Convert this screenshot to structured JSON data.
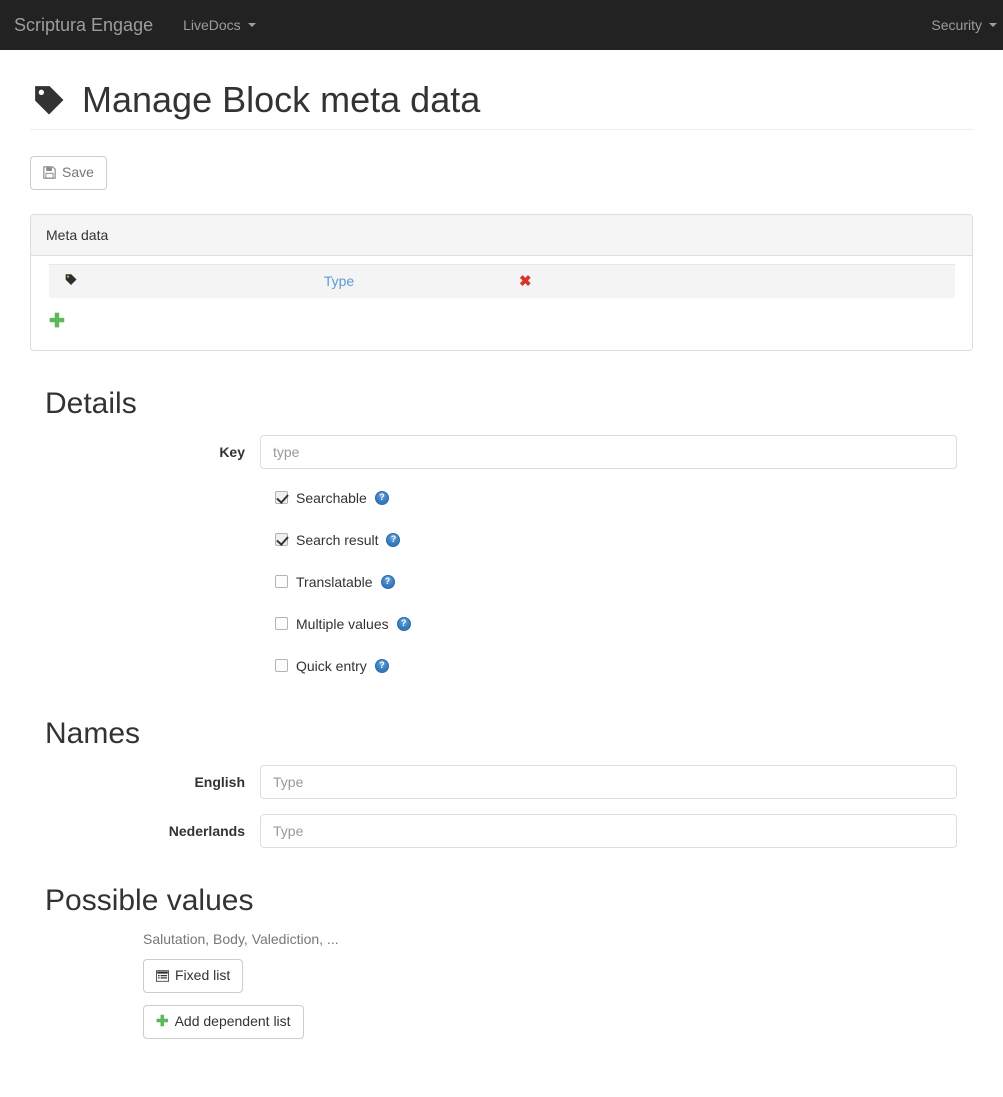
{
  "navbar": {
    "brand": "Scriptura Engage",
    "left_items": [
      {
        "label": "LiveDocs",
        "icon": "caret-down-icon"
      }
    ],
    "right_items": [
      {
        "label": "Security",
        "icon": "caret-down-icon"
      }
    ]
  },
  "header": {
    "icon": "tag-icon",
    "title": "Manage Block meta data"
  },
  "toolbar": {
    "save_label": "Save",
    "save_icon": "save-floppy-icon"
  },
  "meta_panel": {
    "heading": "Meta data",
    "rows": [
      {
        "icon": "tag-icon",
        "name": "Type",
        "delete_icon": "✖"
      }
    ],
    "add_icon": "✚"
  },
  "details": {
    "title": "Details",
    "key_label": "Key",
    "key_value": "",
    "key_placeholder": "type",
    "checkboxes": [
      {
        "label": "Searchable",
        "checked": true,
        "help": "?"
      },
      {
        "label": "Search result",
        "checked": true,
        "help": "?"
      },
      {
        "label": "Translatable",
        "checked": false,
        "help": "?"
      },
      {
        "label": "Multiple values",
        "checked": false,
        "help": "?"
      },
      {
        "label": "Quick entry",
        "checked": false,
        "help": "?"
      }
    ]
  },
  "names": {
    "title": "Names",
    "fields": [
      {
        "label": "English",
        "value": "",
        "placeholder": "Type"
      },
      {
        "label": "Nederlands",
        "value": "",
        "placeholder": "Type"
      }
    ]
  },
  "possible_values": {
    "title": "Possible values",
    "note": "Salutation, Body, Valediction, ...",
    "fixed_list_label": "Fixed list",
    "fixed_list_icon": "list-icon",
    "add_dependent_label": "Add dependent list",
    "add_dependent_icon": "✚"
  },
  "colors": {
    "navbar_bg": "#222222",
    "navbar_text": "#9d9d9d",
    "link_blue": "#5b9bd5",
    "delete_red": "#d9342b",
    "add_green": "#5cb85c",
    "help_blue": "#3a7fc1",
    "panel_border": "#dddddd",
    "panel_heading_bg": "#f5f5f5",
    "row_bg": "#f4f4f4"
  }
}
